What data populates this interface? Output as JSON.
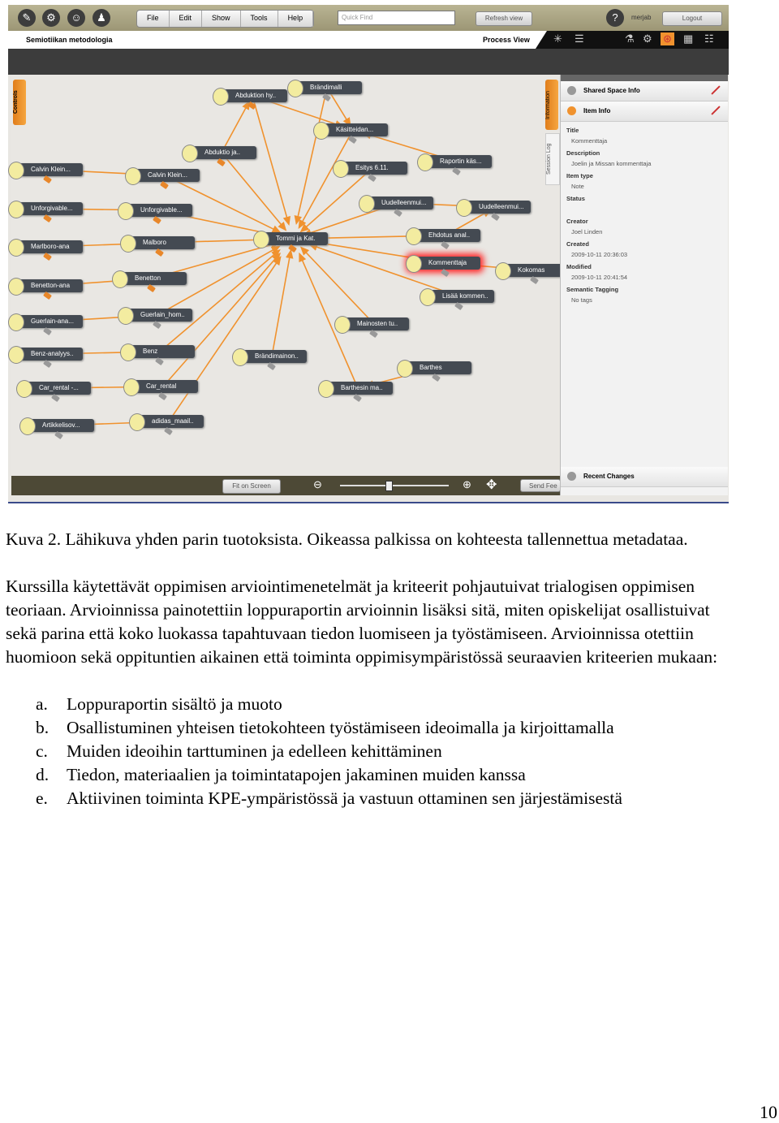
{
  "app": {
    "menu": [
      "File",
      "Edit",
      "Show",
      "Tools",
      "Help"
    ],
    "quick_find_placeholder": "Quick Find",
    "refresh_label": "Refresh view",
    "user": "merjab",
    "logout_label": "Logout",
    "space_title": "Semiotiikan metodologia",
    "view_label": "Process View",
    "controls_tab": "Controls",
    "information_tab": "Information",
    "session_log_tab": "Session Log",
    "fit_label": "Fit on Screen",
    "send_feedback_label": "Send Fee",
    "zoom_level_percent": 45,
    "accent": "#f0922e",
    "nodes": [
      "Abduktion hy..",
      "Brändimalli",
      "Käsitteidan...",
      "Abduktio ja..",
      "Esitys 6.11.",
      "Raportin käs...",
      "Calvin Klein...",
      "Calvin Klein...",
      "Uudelleenmui...",
      "Uudelleenmui...",
      "Unforgivable...",
      "Unforgivable...",
      "Tommi ja Kat.",
      "Ehdotus anal..",
      "Marlboro-ana",
      "Malboro",
      "Kommenttaja",
      "Kokomas",
      "Benetton-ana",
      "Benetton",
      "Lisää kommen..",
      "Guerlain-ana...",
      "Guerlain_hom..",
      "Mainosten tu..",
      "Benz-analyys..",
      "Benz",
      "Brändimainon..",
      "Barthes",
      "Car_rental -...",
      "Car_rental",
      "Barthesin ma..",
      "Artikkelisov...",
      "adidas_maail.."
    ],
    "panel": {
      "shared_space": "Shared Space Info",
      "item_info": "Item Info",
      "fields": [
        {
          "label": "Title",
          "value": "Kommenttaja"
        },
        {
          "label": "Description",
          "value": "Joelin ja Missan kommenttaja"
        },
        {
          "label": "Item type",
          "value": "Note"
        },
        {
          "label": "Status",
          "value": ""
        },
        {
          "label": "Creator",
          "value": "Joel Linden"
        },
        {
          "label": "Created",
          "value": "2009-10-11 20:36:03"
        },
        {
          "label": "Modified",
          "value": "2009-10-11 20:41:54"
        },
        {
          "label": "Semantic Tagging",
          "value": "No tags"
        }
      ],
      "recent_changes": "Recent Changes"
    }
  },
  "doc": {
    "caption": "Kuva 2. Lähikuva yhden parin tuotoksista. Oikeassa palkissa on kohteesta tallennettua metadataa.",
    "paragraph": "Kurssilla käytettävät oppimisen arviointimenetelmät ja kriteerit pohjautuivat trialogisen oppimisen teoriaan. Arvioinnissa painotettiin loppuraportin arvioinnin lisäksi sitä, miten opiskelijat osallistuivat sekä parina että koko luokassa tapahtuvaan tiedon luomiseen ja työstämiseen. Arvioinnissa otettiin huomioon sekä oppituntien aikainen että toiminta oppimisympäristössä seuraavien kriteerien mukaan:",
    "criteria": [
      {
        "marker": "a.",
        "text": "Loppuraportin sisältö ja muoto"
      },
      {
        "marker": "b.",
        "text": "Osallistuminen yhteisen tietokohteen työstämiseen ideoimalla ja kirjoittamalla"
      },
      {
        "marker": "c.",
        "text": "Muiden ideoihin tarttuminen ja edelleen kehittäminen"
      },
      {
        "marker": "d.",
        "text": "Tiedon, materiaalien ja toimintatapojen jakaminen muiden kanssa"
      },
      {
        "marker": "e.",
        "text": "Aktiivinen toiminta KPE-ympäristössä ja vastuun ottaminen sen järjestämisestä"
      }
    ],
    "page_number": "10"
  }
}
